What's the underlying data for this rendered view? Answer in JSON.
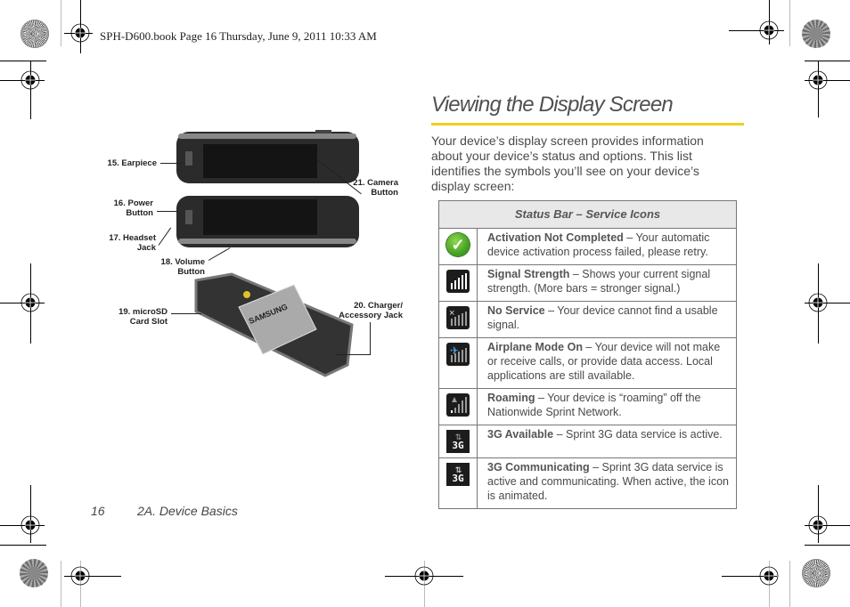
{
  "print_header": "SPH-D600.book  Page 16  Thursday, June 9, 2011  10:33 AM",
  "section": {
    "title": "Viewing the Display Screen",
    "accent_color": "#f0cf1a",
    "intro": "Your device’s display screen provides information about your device’s status and options. This list identifies the symbols you’ll see on your device’s display screen:"
  },
  "table": {
    "header": "Status Bar – Service Icons",
    "rows": [
      {
        "icon": "activation-check-icon",
        "label": "Activation Not Completed",
        "desc": " – Your automatic device activation process failed, please retry."
      },
      {
        "icon": "signal-strength-icon",
        "label": "Signal Strength",
        "desc": " – Shows your current signal strength. (More bars = stronger signal.)"
      },
      {
        "icon": "no-service-icon",
        "label": "No Service",
        "desc": " – Your device cannot find a usable signal."
      },
      {
        "icon": "airplane-mode-icon",
        "label": "Airplane Mode On",
        "desc": " – Your device will not make or receive calls, or provide data access. Local applications are still available."
      },
      {
        "icon": "roaming-icon",
        "label": "Roaming",
        "desc": " – Your device is “roaming” off the Nationwide Sprint Network."
      },
      {
        "icon": "3g-available-icon",
        "label": "3G Available",
        "desc": " – Sprint 3G data service is active."
      },
      {
        "icon": "3g-communicating-icon",
        "label": "3G Communicating",
        "desc": " – Sprint 3G data service is active and communicating. When active, the icon is animated."
      }
    ],
    "icon_text": {
      "check": "✓",
      "x": "×",
      "plane": "✈",
      "g3": "3G",
      "arrows": "⇅"
    }
  },
  "figure": {
    "callouts": {
      "c15": "15. Earpiece",
      "c16a": "16. Power",
      "c16b": "Button",
      "c17a": "17. Headset",
      "c17b": "Jack",
      "c18a": "18. Volume",
      "c18b": "Button",
      "c19a": "19. microSD",
      "c19b": "Card Slot",
      "c20a": "20. Charger/",
      "c20b": "Accessory Jack",
      "c21a": "21. Camera",
      "c21b": "Button"
    },
    "battery_brand": "SAMSUNG"
  },
  "footer": {
    "page_number": "16",
    "section_name": "2A. Device Basics"
  }
}
